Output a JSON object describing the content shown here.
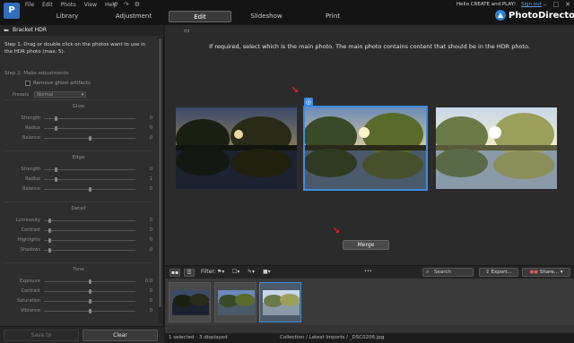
{
  "menu": [
    "File",
    "Edit",
    "Photo",
    "View",
    "Help"
  ],
  "nav_tabs": [
    "Library",
    "Adjustment",
    "Edit",
    "Slideshow",
    "Print"
  ],
  "active_tab": "Edit",
  "user": {
    "greeting": "Hello CREATE and PLAY!",
    "signout": "Sign out"
  },
  "brand": "PhotoDirector",
  "panel": {
    "title": "Bracket HDR",
    "step1": "Step 1. Drag or double click on the photos  want to use in the HDR photo (max: 5).",
    "step2": "Step 2. Make adjustments",
    "ghost_label": "Remove ghost artifacts",
    "presets_label": "Presets",
    "presets_value": "Normal",
    "groups": [
      {
        "title": "Glow",
        "sliders": [
          {
            "label": "Strength",
            "value": "0",
            "pos": 0.12
          },
          {
            "label": "Radius",
            "value": "0",
            "pos": 0.12
          },
          {
            "label": "Balance",
            "value": "0",
            "pos": 0.5
          }
        ]
      },
      {
        "title": "Edge",
        "sliders": [
          {
            "label": "Strength",
            "value": "0",
            "pos": 0.12
          },
          {
            "label": "Radius",
            "value": "1",
            "pos": 0.12
          },
          {
            "label": "Balance",
            "value": "0",
            "pos": 0.5
          }
        ]
      },
      {
        "title": "Detail",
        "sliders": [
          {
            "label": "Luminosity",
            "value": "0",
            "pos": 0.05
          },
          {
            "label": "Contrast",
            "value": "0",
            "pos": 0.05
          },
          {
            "label": "Highlights",
            "value": "0",
            "pos": 0.05
          },
          {
            "label": "Shadows",
            "value": "0",
            "pos": 0.05
          }
        ]
      },
      {
        "title": "Tone",
        "sliders": [
          {
            "label": "Exposure",
            "value": "0.0",
            "pos": 0.5
          },
          {
            "label": "Contrast",
            "value": "0",
            "pos": 0.5
          },
          {
            "label": "Saturation",
            "value": "0",
            "pos": 0.5
          },
          {
            "label": "Vibrance",
            "value": "0",
            "pos": 0.5
          }
        ]
      }
    ],
    "save_to": "Save to",
    "clear": "Clear"
  },
  "stage": {
    "instruction": "If required, select which is the main photo. The main photo contains content that should be in the HDR photo.",
    "merge": "Merge"
  },
  "toolbar": {
    "filter_label": "Filter:",
    "search_placeholder": "Search",
    "export": "Export...",
    "share": "Share..."
  },
  "status": {
    "selection": "1 selected - 3 displayed",
    "path": "Collection / Latest Imports / _DSC0206.jpg"
  },
  "colors": {
    "accent": "#3d8be0",
    "arrow": "#e02020"
  }
}
